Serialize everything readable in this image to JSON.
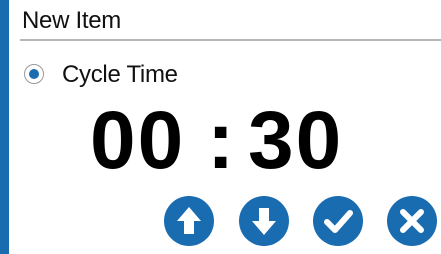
{
  "header": {
    "title": "New Item"
  },
  "option": {
    "label": "Cycle Time",
    "selected": true
  },
  "timer": {
    "minutes": "00",
    "separator": ":",
    "seconds": "30"
  },
  "buttons": [
    {
      "name": "increase",
      "icon": "arrow-up-icon"
    },
    {
      "name": "decrease",
      "icon": "arrow-down-icon"
    },
    {
      "name": "confirm",
      "icon": "check-icon"
    },
    {
      "name": "cancel",
      "icon": "close-icon"
    }
  ],
  "colors": {
    "accent": "#1a6cb1",
    "text": "#111111",
    "divider": "#b7b7b7"
  }
}
